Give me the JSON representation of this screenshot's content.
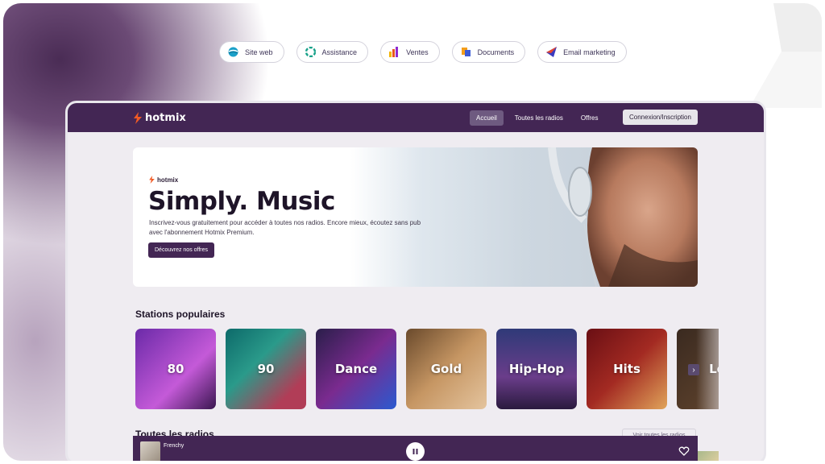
{
  "pills": [
    {
      "label": "Site web",
      "icon": "globe-icon"
    },
    {
      "label": "Assistance",
      "icon": "support-icon"
    },
    {
      "label": "Ventes",
      "icon": "chart-icon"
    },
    {
      "label": "Documents",
      "icon": "documents-icon"
    },
    {
      "label": "Email marketing",
      "icon": "send-icon"
    }
  ],
  "app": {
    "logo": "hotmix",
    "nav": [
      "Accueil",
      "Toutes les radios",
      "Offres"
    ],
    "nav_active": "Accueil",
    "login_label": "Connexion/Inscription"
  },
  "hero": {
    "brand": "hotmix",
    "title": "Simply. Music",
    "text": "Inscrivez-vous gratuitement pour accéder à toutes nos radios. Encore mieux, écoutez sans pub avec l'abonnement Hotmix Premium.",
    "button_label": "Découvrez nos offres"
  },
  "stations_section": {
    "title": "Stations populaires",
    "items": [
      "80",
      "90",
      "Dance",
      "Gold",
      "Hip-Hop",
      "Hits",
      "Lo"
    ]
  },
  "all_radios": {
    "title": "Toutes les radios",
    "see_all_label": "Voir toutes les radios"
  },
  "player": {
    "station": "Frenchy"
  },
  "colors": {
    "brand": "#432654",
    "accent": "#f15a24"
  }
}
